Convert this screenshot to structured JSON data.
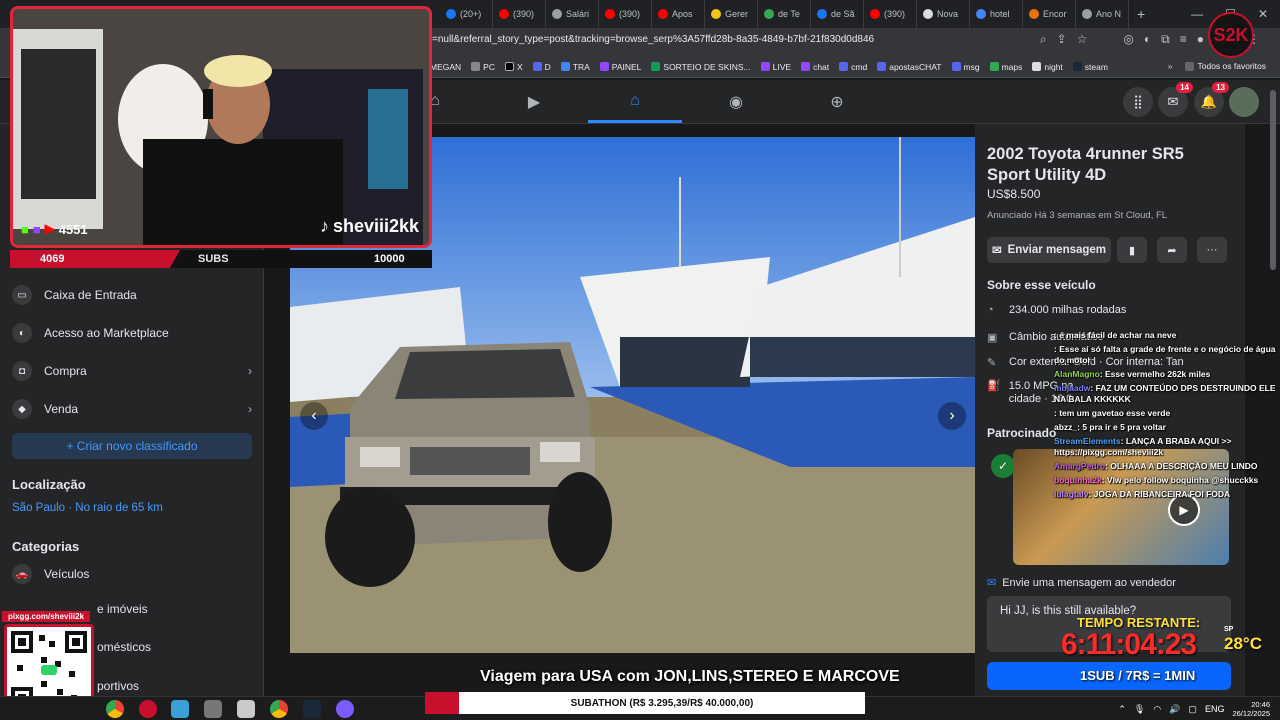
{
  "browser": {
    "tabs": [
      "(20+)",
      "(390)",
      "Salári",
      "(390)",
      "Apos",
      "Gerer",
      "de Te",
      "de Sã",
      "(390)",
      "Nova",
      "hotel",
      "Encor",
      "Ano N"
    ],
    "url": "=null&referral_story_type=post&tracking=browse_serp%3A57ffd28b-8a35-4849-b7bf-21f830d0d846",
    "bookmarks": [
      "MEGAN",
      "PC",
      "X",
      "D",
      "TRA",
      "PAINEL",
      "SORTEIO DE SKINS...",
      "LIVE",
      "chat",
      "cmd",
      "apostasCHAT",
      "msg",
      "maps",
      "night",
      "steam"
    ],
    "bookmarks_all": "Todos os favoritos"
  },
  "fb": {
    "messenger_badge": "14",
    "notif_badge": "13"
  },
  "sidebar": {
    "items": [
      {
        "label": "Caixa de Entrada",
        "icon": "inbox-icon"
      },
      {
        "label": "Acesso ao Marketplace",
        "icon": "marketplace-access-icon"
      },
      {
        "label": "Compra",
        "icon": "shopping-bag-icon"
      },
      {
        "label": "Venda",
        "icon": "sell-icon"
      }
    ],
    "new_listing": "+ Criar novo classificado",
    "location_heading": "Localização",
    "location_value": "São Paulo · No raio de 65 km",
    "categories_heading": "Categorias",
    "categories": [
      "Veículos",
      "e imóveis",
      "omésticos",
      "portivos"
    ]
  },
  "listing": {
    "title": "2002 Toyota 4runner SR5 Sport Utility 4D",
    "price": "US$8.500",
    "listed": "Anunciado Há 3 semanas em St Cloud, FL",
    "send_message": "Enviar mensagem",
    "about_heading": "Sobre esse veículo",
    "details": [
      "234.000 milhas rodadas",
      "Câmbio automático",
      "Cor externa: Gold · Cor interna: Tan",
      "15.0 MPG na cidade · 16.0 MPG na estrada"
    ],
    "sponsored_heading": "Patrocinado",
    "send_to_seller": "Envie uma mensagem ao vendedor",
    "message_text": "Hi JJ, is this still available?"
  },
  "stream": {
    "viewer_count": "4551",
    "channel": "sheviii2kk",
    "subs_count": "4069",
    "subs_label": "SUBS",
    "subs_goal": "10000",
    "logo_text": "S2K",
    "qr_label": "pixgg.com/sheviii2k",
    "caption": "Viagem para USA com JON,LINS,STEREO E MARCOVE",
    "timer_label": "TEMPO RESTANTE:",
    "timer": "6:11:04:23",
    "temp_city": "SP",
    "temp": "28°C",
    "rate": "1SUB / 7R$ = 1MIN",
    "subathon": "SUBATHON (R$ 3.295,39/R$ 40.000,00)",
    "chat": [
      {
        "user": "",
        "text": ": é mais fácil de achar na neve",
        "color": "#3fd66c"
      },
      {
        "user": "",
        "text": ": Esse aí só falta a grade de frente e o negócio de água do motor",
        "color": "#ff4b4b"
      },
      {
        "user": "AlanMagno",
        "text": ": Esse vermelho 262k miles",
        "color": "#8fd14f"
      },
      {
        "user": "mbjaadw",
        "text": ": FAZ UM CONTEÚDO DPS DESTRUINDO ELE NA BALA KKKKKK",
        "color": "#7f7fff"
      },
      {
        "user": "",
        "text": ": tem um gavetao esse verde",
        "color": "#5a8dff"
      },
      {
        "user": "abzz_",
        "text": ": 5 pra ir e 5 pra voltar",
        "color": "#ffffff"
      },
      {
        "user": "StreamElements",
        "text": ": LANÇA A BRABA AQUI >> https://pixgg.com/sheviii2k",
        "color": "#4aa3ff"
      },
      {
        "user": "AmargPedro",
        "text": ": OLHAAA A DESCRIÇÃO MEU LINDO",
        "color": "#c15ee6"
      },
      {
        "user": "boquinha2k",
        "text": ": Vlw pelo follow boquinha @shucckks",
        "color": "#ff5fd2"
      },
      {
        "user": "lulagtalv",
        "text": ": JOGA DA RIBANCEIRA FOI FODA",
        "color": "#c084ff"
      }
    ]
  },
  "taskbar": {
    "lang": "ENG",
    "time": "20:46",
    "date": "26/12/2025"
  }
}
